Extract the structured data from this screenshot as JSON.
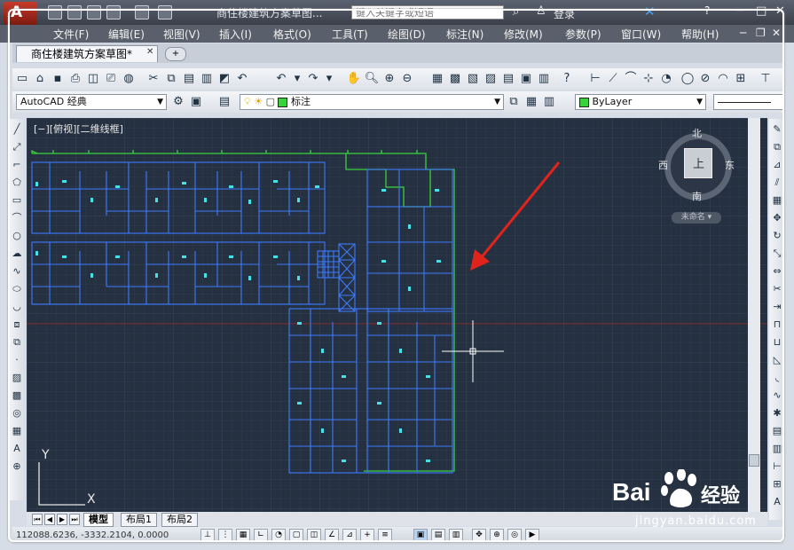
{
  "titlebar": {
    "document_title": "商住楼建筑方案草图...",
    "search_placeholder": "键入关键字或短语",
    "login_label": "登录"
  },
  "menu": {
    "items": [
      "文件(F)",
      "编辑(E)",
      "视图(V)",
      "插入(I)",
      "格式(O)",
      "工具(T)",
      "绘图(D)",
      "标注(N)",
      "修改(M)",
      "参数(P)",
      "窗口(W)",
      "帮助(H)"
    ]
  },
  "tabs": {
    "document_tab": "商住楼建筑方案草图*"
  },
  "toolbar2": {
    "workspace": "AutoCAD 经典",
    "layer": "标注",
    "color": "ByLayer"
  },
  "viewport": {
    "label": "[−][俯视][二维线框]"
  },
  "compass": {
    "north": "北",
    "south": "南",
    "east": "东",
    "west": "西",
    "face": "上",
    "ucs_name": "未命名"
  },
  "ucs_axis": {
    "x": "X",
    "y": "Y"
  },
  "layout_tabs": [
    "模型",
    "布局1",
    "布局2"
  ],
  "statusbar": {
    "coordinates": "112088.6236, -3332.2104, 0.0000"
  },
  "watermark": {
    "logo_text": "Bai",
    "logo_text_cn": "经验",
    "url": "jingyan.baidu.com"
  },
  "colors": {
    "canvas_bg": "#253041",
    "wall_blue": "#3d7bff",
    "outline_green": "#39d23c",
    "arrow_red": "#e0241c"
  }
}
